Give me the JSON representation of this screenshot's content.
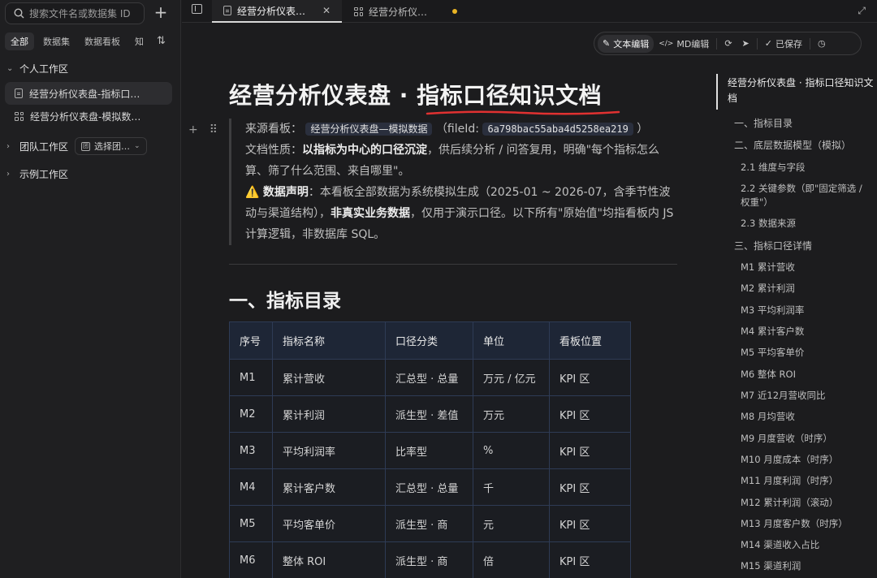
{
  "sidebar": {
    "search_placeholder": "搜索文件名或数据集 ID",
    "filters": [
      "全部",
      "数据集",
      "数据看板",
      "知"
    ],
    "groups": {
      "personal": "个人工作区",
      "team": "团队工作区",
      "team_select": "选择团…",
      "example": "示例工作区"
    },
    "files": [
      "经营分析仪表盘-指标口…",
      "经营分析仪表盘-模拟数…"
    ]
  },
  "tabs": [
    {
      "label": "经营分析仪表…"
    },
    {
      "label": "经营分析仪…"
    }
  ],
  "toolbar": {
    "text_edit": "文本编辑",
    "md_edit": "MD编辑",
    "saved": "已保存"
  },
  "doc": {
    "title": "经营分析仪表盘 · 指标口径知识文档",
    "source_label": "来源看板：",
    "source_name": "经营分析仪表盘—模拟数据",
    "file_id_prefix": "（fileId:",
    "file_id": "6a798bac55aba4d5258ea219",
    "file_id_suffix": "）",
    "nature_label": "文档性质：",
    "nature_bold": "以指标为中心的口径沉淀",
    "nature_text": "，供后续分析 / 问答复用，明确\"每个指标怎么算、筛了什么范围、来自哪里\"。",
    "warning_icon": "⚠️",
    "decl_label": "数据声明",
    "decl_text1": "：本看板全部数据为系统模拟生成（2025-01 ~ 2026-07，含季节性波动与渠道结构），",
    "decl_bold": "非真实业务数据",
    "decl_text2": "，仅用于演示口径。以下所有\"原始值\"均指看板内 JS 计算逻辑，非数据库 SQL。",
    "section1": "一、指标目录"
  },
  "table": {
    "headers": [
      "序号",
      "指标名称",
      "口径分类",
      "单位",
      "看板位置"
    ],
    "rows": [
      [
        "M1",
        "累计营收",
        "汇总型 · 总量",
        "万元 / 亿元",
        "KPI 区"
      ],
      [
        "M2",
        "累计利润",
        "派生型 · 差值",
        "万元",
        "KPI 区"
      ],
      [
        "M3",
        "平均利润率",
        "比率型",
        "%",
        "KPI 区"
      ],
      [
        "M4",
        "累计客户数",
        "汇总型 · 总量",
        "千",
        "KPI 区"
      ],
      [
        "M5",
        "平均客单价",
        "派生型 · 商",
        "元",
        "KPI 区"
      ],
      [
        "M6",
        "整体 ROI",
        "派生型 · 商",
        "倍",
        "KPI 区"
      ]
    ]
  },
  "toc": {
    "title": "经营分析仪表盘 · 指标口径知识文档",
    "items": [
      "一、指标目录",
      "二、底层数据模型（模拟）",
      "2.1 维度与字段",
      "2.2 关键参数（即\"固定筛选 / 权重\"）",
      "2.3 数据来源",
      "三、指标口径详情",
      "M1 累计营收",
      "M2 累计利润",
      "M3 平均利润率",
      "M4 累计客户数",
      "M5 平均客单价",
      "M6 整体 ROI",
      "M7 近12月营收同比",
      "M8 月均营收",
      "M9 月度营收（时序）",
      "M10 月度成本（时序）",
      "M11 月度利润（时序）",
      "M12 累计利润（滚动）",
      "M13 月度客户数（时序）",
      "M14 渠道收入占比",
      "M15 渠道利润"
    ]
  },
  "colors": {
    "accent_underline": "#e03131",
    "unsaved_dot": "#e9b424"
  }
}
